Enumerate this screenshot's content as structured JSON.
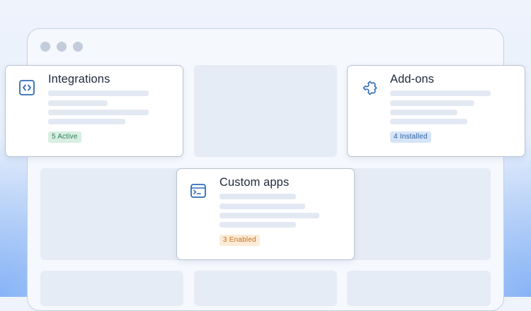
{
  "colors": {
    "accent_blue": "#2f6db5",
    "badge_active": "#2f7f57",
    "badge_installed": "#2b5e9e",
    "badge_enabled": "#c4721d"
  },
  "window": {
    "controls": [
      "window-dot-1",
      "window-dot-2",
      "window-dot-3"
    ]
  },
  "cards": {
    "integrations": {
      "title": "Integrations",
      "icon": "code-brackets-icon",
      "badge": "5 Active"
    },
    "addons": {
      "title": "Add-ons",
      "icon": "puzzle-piece-icon",
      "badge": "4 Installed"
    },
    "custom_apps": {
      "title": "Custom apps",
      "icon": "terminal-window-icon",
      "badge": "3 Enabled"
    }
  }
}
